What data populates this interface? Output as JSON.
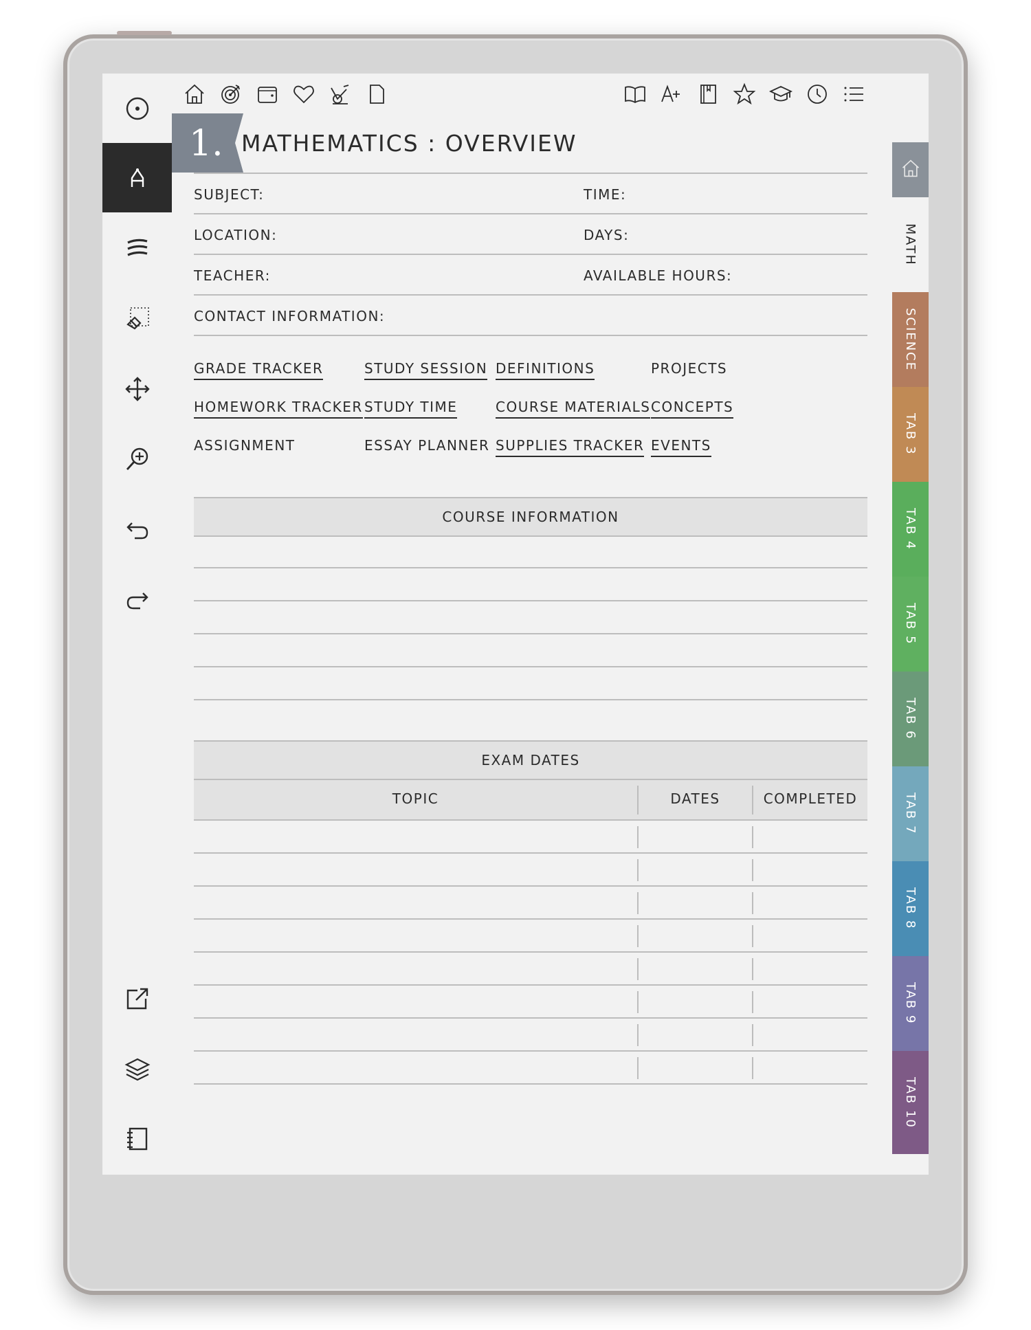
{
  "header": {
    "section_number": "1.",
    "title": "MATHEMATICS : OVERVIEW"
  },
  "top_icons_left": [
    "home-icon",
    "target-icon",
    "wallet-icon",
    "heart-icon",
    "exercise-bike-icon",
    "page-icon"
  ],
  "top_icons_right": [
    "book-open-icon",
    "a-plus-icon",
    "notebook-icon",
    "star-icon",
    "graduation-cap-icon",
    "clock-icon",
    "list-icon"
  ],
  "toolbar_icons": [
    "menu-circle-icon",
    "pen-tool-icon",
    "brush-icon",
    "eraser-select-icon",
    "move-icon",
    "zoom-icon",
    "undo-icon",
    "redo-icon",
    "share-icon",
    "layers-icon",
    "notebook-icon"
  ],
  "fields": {
    "subject": "SUBJECT:",
    "time": "TIME:",
    "location": "LOCATION:",
    "days": "DAYS:",
    "teacher": "TEACHER:",
    "available_hours": "AVAILABLE HOURS:",
    "contact": "CONTACT INFORMATION:"
  },
  "links": [
    {
      "label": "GRADE TRACKER",
      "underlined": true
    },
    {
      "label": "STUDY SESSION",
      "underlined": true
    },
    {
      "label": "DEFINITIONS",
      "underlined": true
    },
    {
      "label": "PROJECTS",
      "underlined": false
    },
    {
      "label": "HOMEWORK TRACKER",
      "underlined": true
    },
    {
      "label": "STUDY TIME",
      "underlined": true
    },
    {
      "label": "COURSE MATERIALS",
      "underlined": true
    },
    {
      "label": "CONCEPTS",
      "underlined": true
    },
    {
      "label": "ASSIGNMENT",
      "underlined": false
    },
    {
      "label": "ESSAY PLANNER",
      "underlined": false
    },
    {
      "label": "SUPPLIES TRACKER",
      "underlined": true
    },
    {
      "label": "EVENTS",
      "underlined": true
    }
  ],
  "course_information": {
    "title": "COURSE INFORMATION"
  },
  "exam_dates": {
    "title": "EXAM DATES",
    "columns": [
      "TOPIC",
      "DATES",
      "COMPLETED"
    ]
  },
  "tabs": [
    {
      "label": "",
      "icon": "home-icon",
      "color": "#8a9199"
    },
    {
      "label": "MATH",
      "color": "#f2f2f2"
    },
    {
      "label": "SCIENCE",
      "color": "#b37c5e"
    },
    {
      "label": "TAB 3",
      "color": "#c08a55"
    },
    {
      "label": "TAB 4",
      "color": "#5aae5c"
    },
    {
      "label": "TAB 5",
      "color": "#5fb060"
    },
    {
      "label": "TAB 6",
      "color": "#6b9a79"
    },
    {
      "label": "TAB 7",
      "color": "#74a8bc"
    },
    {
      "label": "TAB 8",
      "color": "#4a8db4"
    },
    {
      "label": "TAB 9",
      "color": "#7775a8"
    },
    {
      "label": "TAB 10",
      "color": "#7e5a86"
    }
  ],
  "colors": {
    "ink": "#2b2b2b",
    "badge": "#7d8590",
    "band": "#e2e2e2"
  }
}
